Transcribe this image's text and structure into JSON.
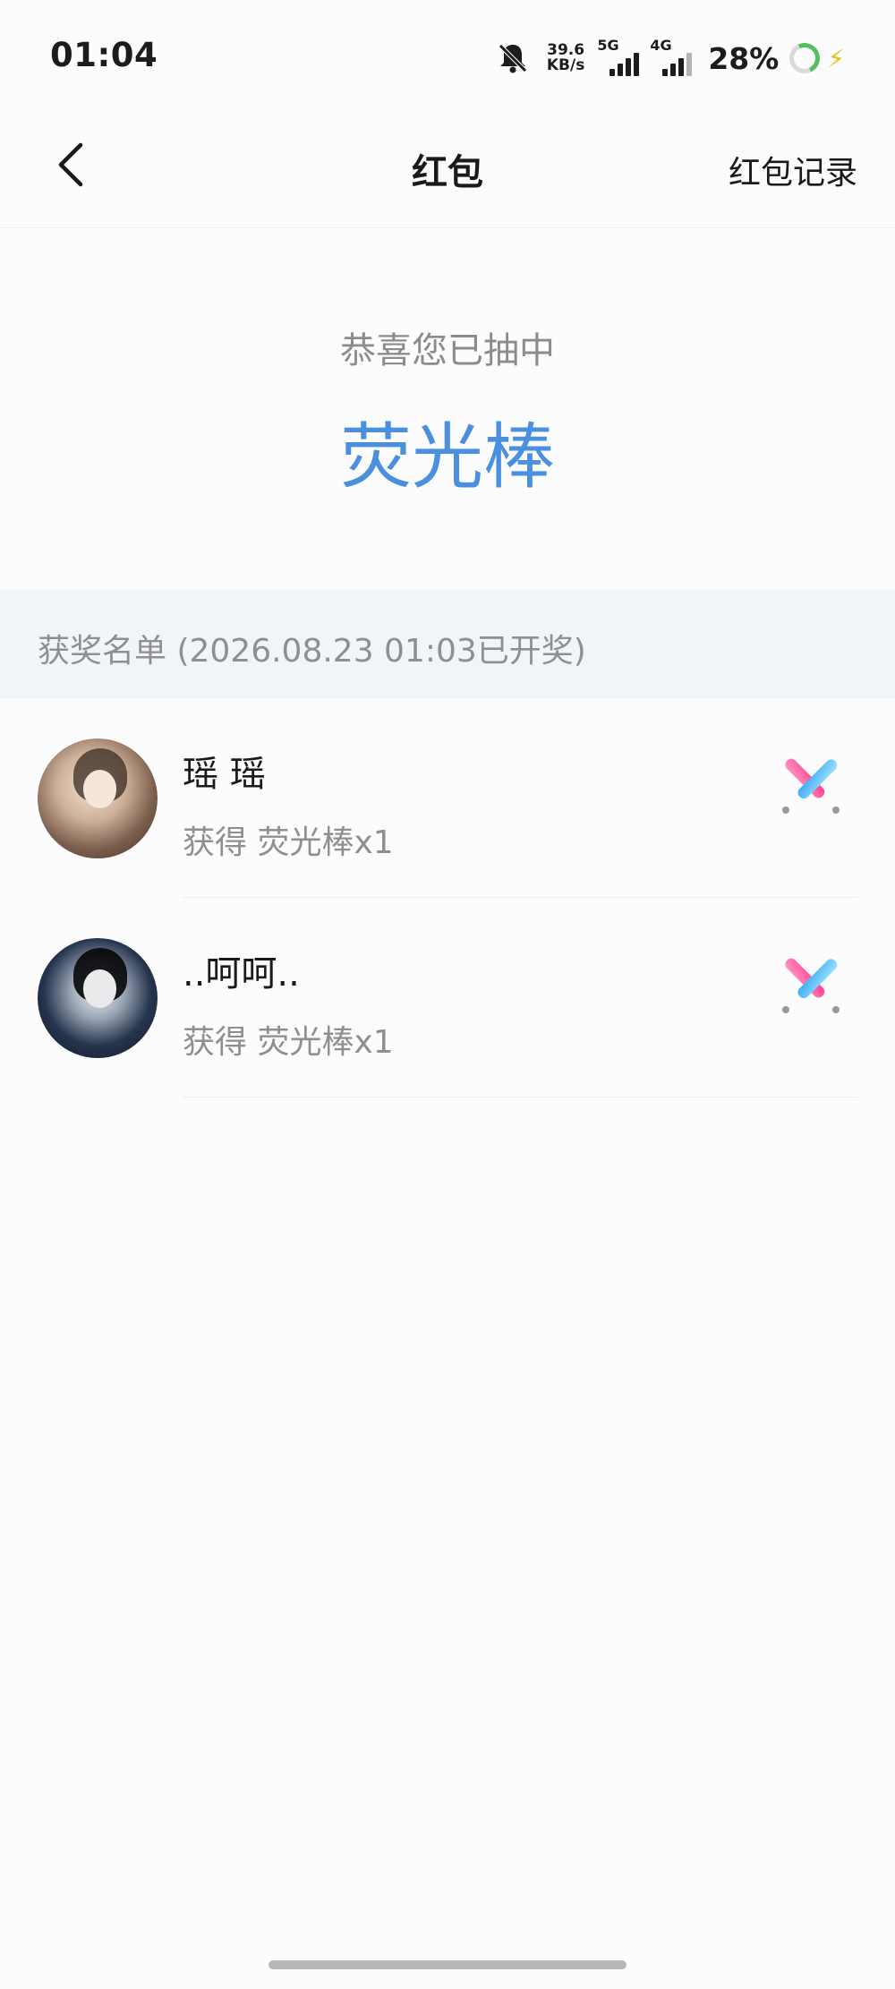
{
  "status_bar": {
    "time": "01:04",
    "net_speed_value": "39.6",
    "net_speed_unit": "KB/s",
    "sim1_tag": "5G",
    "sim2_tag": "4G",
    "battery": "28%",
    "icons": [
      "bell-muted-icon",
      "signal-icon",
      "battery-ring-icon",
      "charging-bolt-icon"
    ]
  },
  "nav": {
    "title": "红包",
    "right_link": "红包记录",
    "back_icon": "chevron-left-icon"
  },
  "hero": {
    "subtitle": "恭喜您已抽中",
    "prize": "荧光棒"
  },
  "winners": {
    "header": "获奖名单 (2026.08.23 01:03已开奖)",
    "items": [
      {
        "name": "瑶  瑶",
        "desc": "获得 荧光棒x1",
        "prize_icon": "glowstick-icon"
      },
      {
        "name": "..呵呵..",
        "desc": "获得 荧光棒x1",
        "prize_icon": "glowstick-icon"
      }
    ]
  },
  "colors": {
    "accent_blue": "#4a8fe0",
    "muted_text": "#8f8f8f",
    "section_bg": "#f1f4f8"
  }
}
